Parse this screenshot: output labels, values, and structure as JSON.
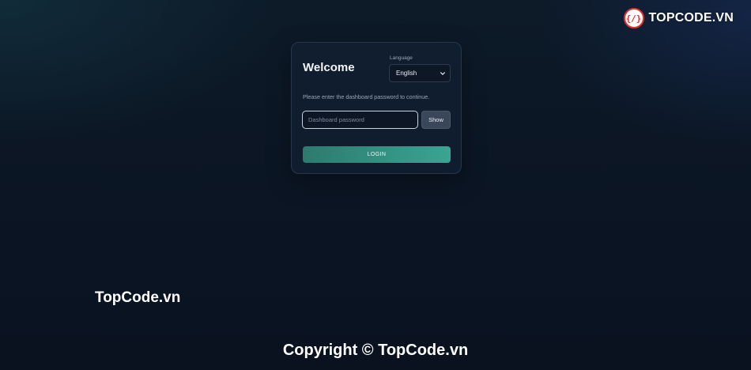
{
  "watermark": {
    "logo_badge": "{/}",
    "logo_text": "TOPCODE.VN",
    "mid_text": "TopCode.vn",
    "copyright": "Copyright © TopCode.vn"
  },
  "login": {
    "title": "Welcome",
    "language_label": "Language",
    "language_value": "English",
    "hint": "Please enter the dashboard password to continue.",
    "password_placeholder": "Dashboard password",
    "password_value": "",
    "show_label": "Show",
    "login_label": "LOGIN"
  },
  "icons": {
    "select_arrow": "chevron-down-icon"
  },
  "colors": {
    "background": "#0b1523",
    "card": "#111e30",
    "accent_start": "#2d7a6e",
    "accent_end": "#3aa493",
    "show_button": "#3a475a"
  }
}
